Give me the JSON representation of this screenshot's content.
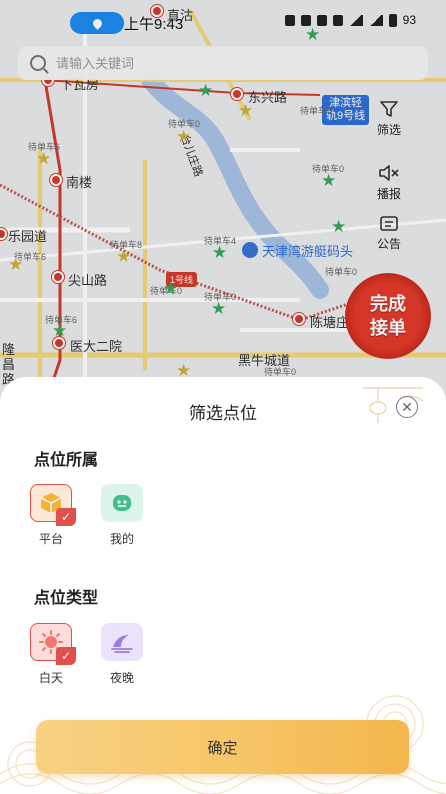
{
  "status_bar": {
    "time": "上午9:43",
    "battery": "93",
    "location_icon": "location-pin-icon"
  },
  "search": {
    "placeholder": "请输入关键词"
  },
  "map": {
    "labels": {
      "zhigu": "直沽",
      "dongxinglu": "东兴路",
      "nanlou": "南楼",
      "leyuandao": "乐园道",
      "jianshanlu": "尖山路",
      "yidaeryuan": "医大二院",
      "tianjinwan": "天津湾游艇码头",
      "chenliangjie": "陈塘庄",
      "heiniucheng": "黑牛城道",
      "longchang": "隆昌路",
      "taierzhuang": "台儿庄路",
      "xiabianfang": "下瓦房",
      "metro_badge_line1": "津滨轻",
      "metro_badge_line2": "轨9号线",
      "line_chip": "1号线"
    },
    "pending_labels": {
      "p1": "待单车0",
      "p2": "待单车6",
      "p3": "待单车0",
      "p4": "待单车4",
      "p5": "待单车8",
      "p6": "待单车0",
      "p7": "待单车0",
      "p8": "待单车6",
      "p9": "待单车6",
      "p10": "待单车0",
      "p11": "待单车0",
      "p12": "待单车6"
    },
    "colors": {
      "metro_red": "#d23b2c",
      "star_green": "#3ba55a",
      "water": "#a8c2e6"
    }
  },
  "tools": {
    "filter_label": "筛选",
    "broadcast_label": "播报",
    "notice_label": "公告"
  },
  "complete_badge": {
    "line1": "完成",
    "line2": "接单"
  },
  "sheet": {
    "title": "筛选点位",
    "section_owner": {
      "title": "点位所属",
      "options": [
        {
          "label": "平台",
          "icon": "platform-box-icon",
          "selected": true
        },
        {
          "label": "我的",
          "icon": "my-robot-icon",
          "selected": false
        }
      ]
    },
    "section_type": {
      "title": "点位类型",
      "options": [
        {
          "label": "白天",
          "icon": "sun-icon",
          "selected": true
        },
        {
          "label": "夜晚",
          "icon": "night-icon",
          "selected": false
        }
      ]
    },
    "confirm_label": "确定",
    "accent": "#e0504a",
    "button_color": "#f6c463"
  }
}
